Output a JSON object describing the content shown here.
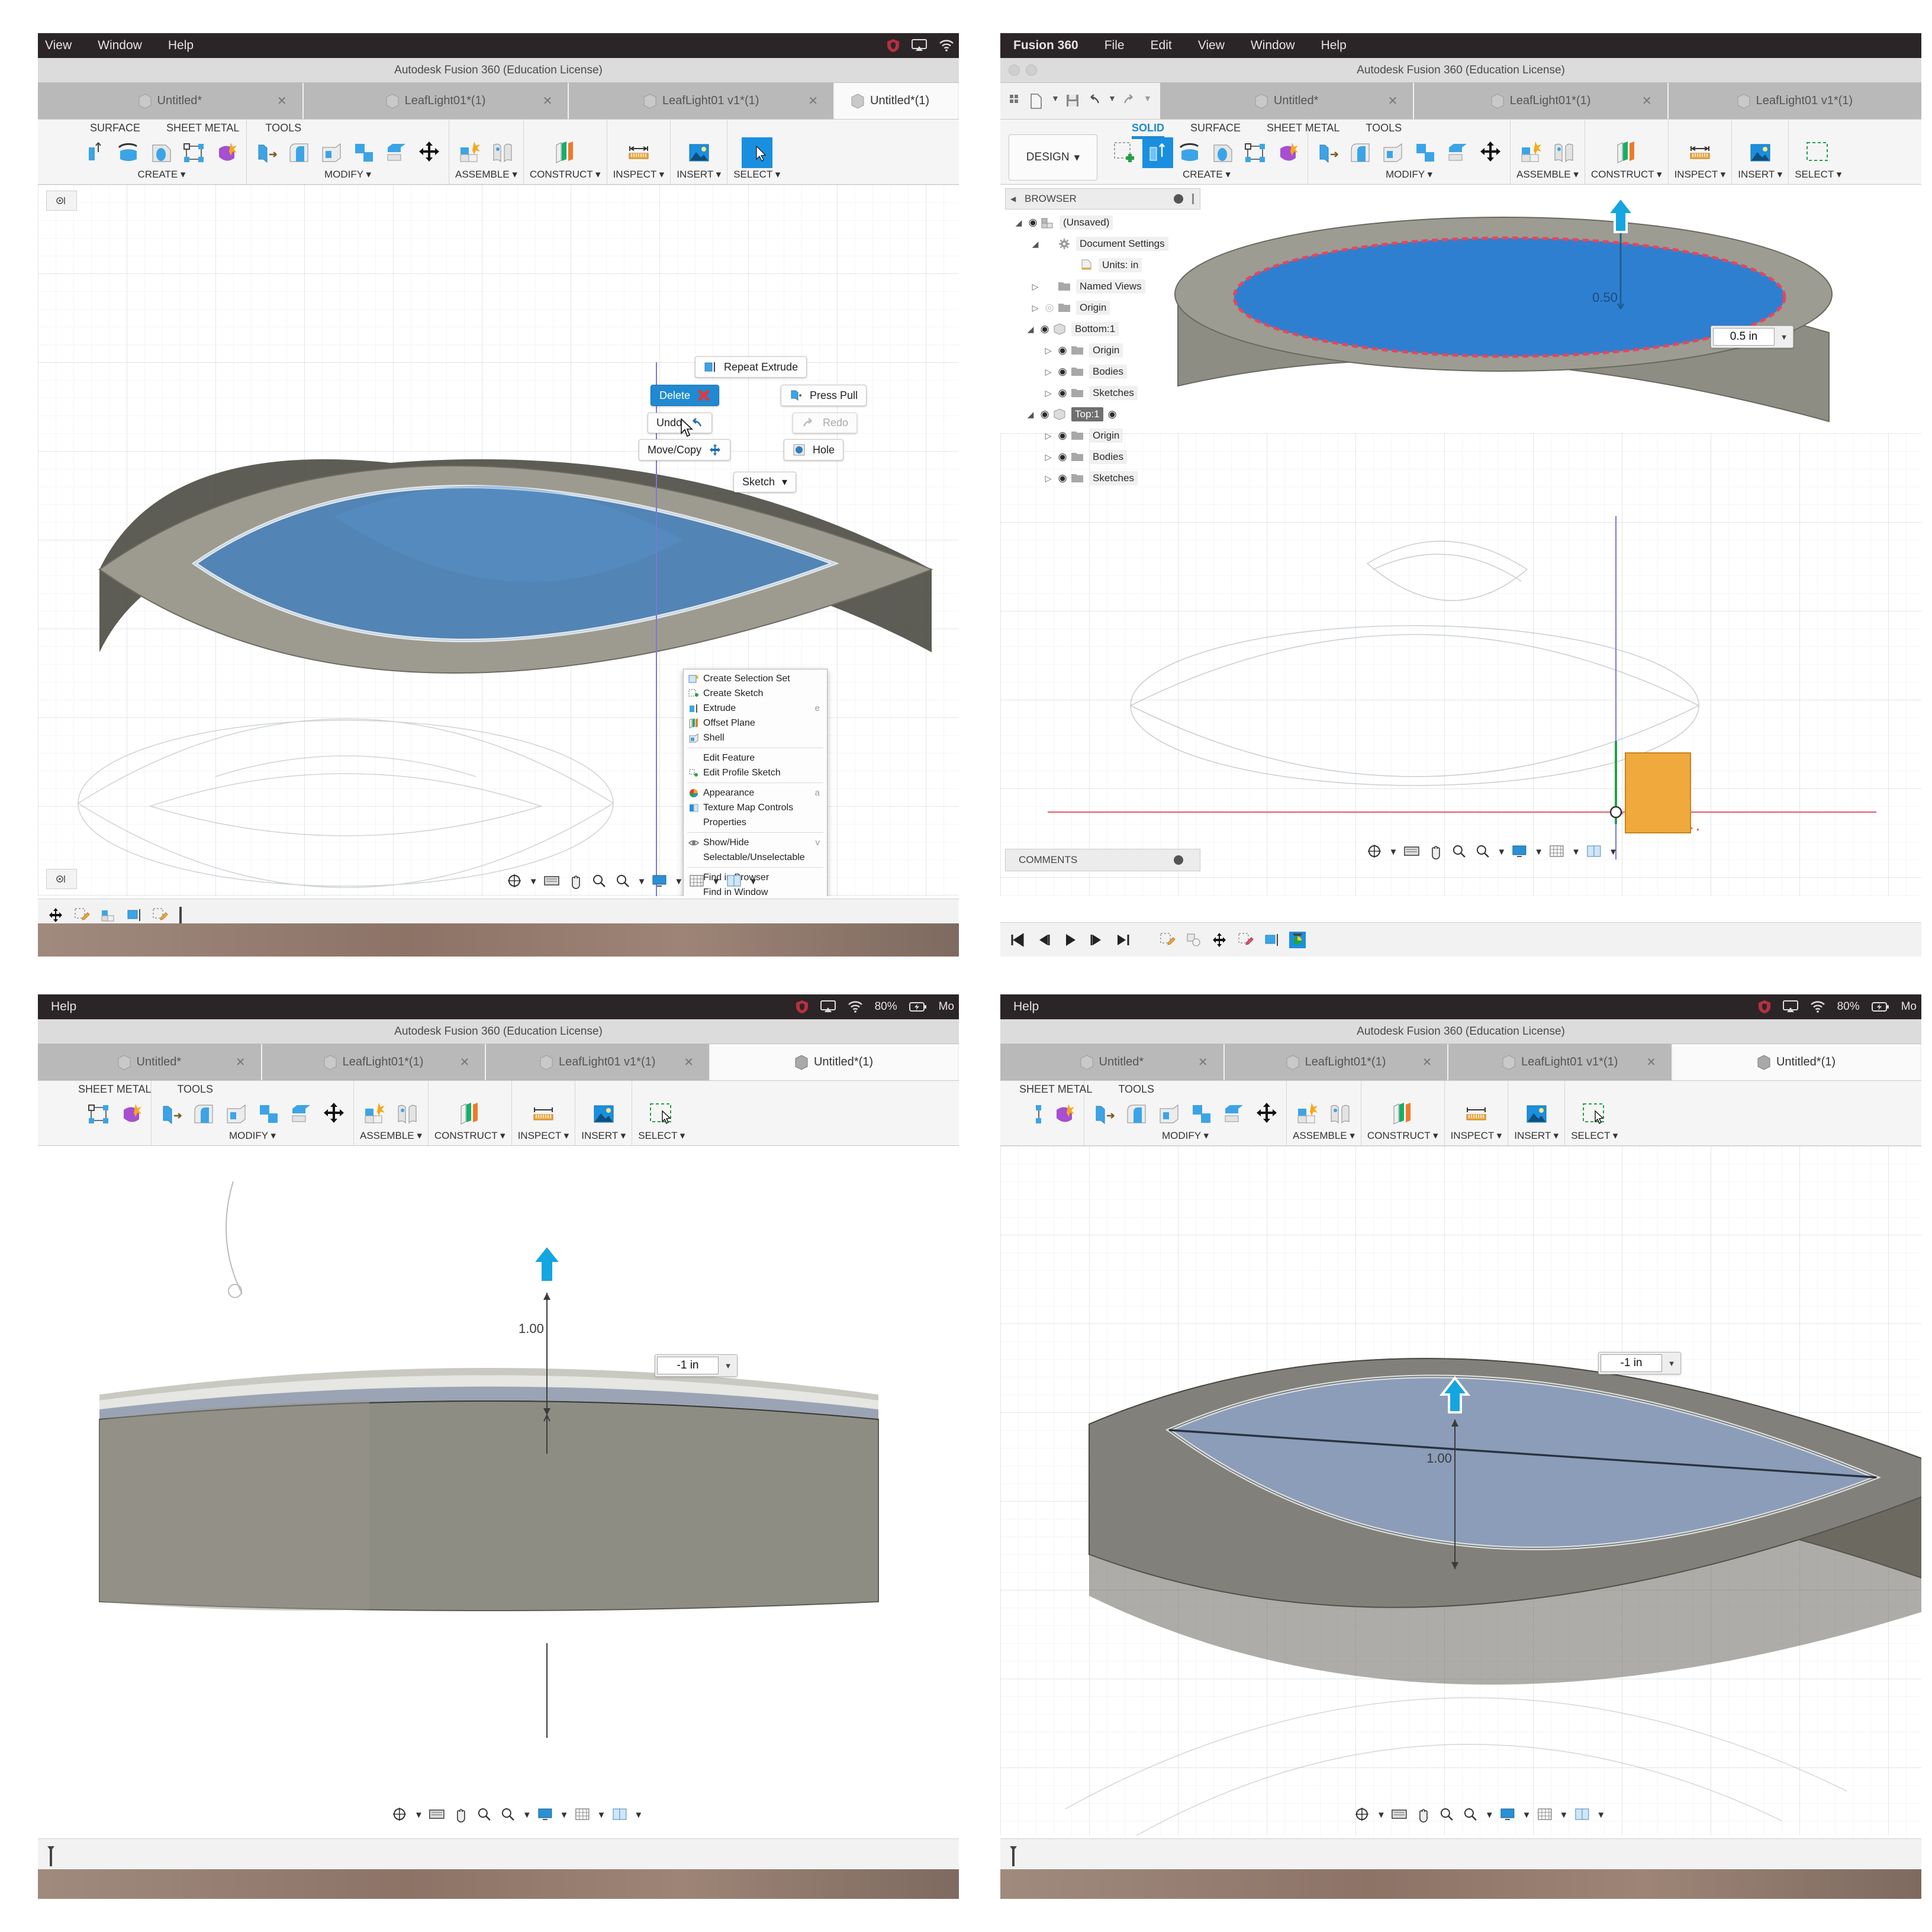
{
  "app": {
    "name": "Fusion 360",
    "window_title": "Autodesk Fusion 360 (Education License)"
  },
  "menus": {
    "full": [
      "Fusion 360",
      "File",
      "Edit",
      "View",
      "Window",
      "Help"
    ],
    "clipped_left": [
      "View",
      "Window",
      "Help"
    ],
    "help_only": [
      "Help"
    ],
    "status": {
      "battery": "80%",
      "trailing": "Mo"
    }
  },
  "document_tabs": [
    {
      "label": "Untitled*",
      "active": false,
      "closable": true
    },
    {
      "label": "LeafLight01*(1)",
      "active": false,
      "closable": true
    },
    {
      "label": "LeafLight01 v1*(1)",
      "active": false,
      "closable": true
    },
    {
      "label": "Untitled*(1)",
      "active": true,
      "closable": false
    }
  ],
  "ribbon": {
    "workspace": "DESIGN",
    "tabs": [
      {
        "label": "SOLID",
        "selected": true
      },
      {
        "label": "SURFACE",
        "selected": false
      },
      {
        "label": "SHEET METAL",
        "selected": false
      },
      {
        "label": "TOOLS",
        "selected": false
      }
    ],
    "tabs_clipped": [
      {
        "label": "SURFACE",
        "selected": false
      },
      {
        "label": "SHEET METAL",
        "selected": false
      },
      {
        "label": "TOOLS",
        "selected": false
      }
    ],
    "tabs_clipped2": [
      {
        "label": "SHEET METAL",
        "selected": false
      },
      {
        "label": "TOOLS",
        "selected": false
      }
    ],
    "groups": [
      {
        "label": "CREATE ▾",
        "icons": [
          "create-sketch-icon",
          "extrude-icon",
          "revolve-icon",
          "sweep-icon",
          "pattern-icon",
          "form-icon"
        ]
      },
      {
        "label": "MODIFY ▾",
        "icons": [
          "press-pull-icon",
          "fillet-icon",
          "shell-icon",
          "draft-icon",
          "split-face-icon",
          "move-copy-icon"
        ]
      },
      {
        "label": "ASSEMBLE ▾",
        "icons": [
          "new-component-icon",
          "joint-icon"
        ]
      },
      {
        "label": "CONSTRUCT ▾",
        "icons": [
          "offset-plane-icon"
        ]
      },
      {
        "label": "INSPECT ▾",
        "icons": [
          "measure-icon"
        ]
      },
      {
        "label": "INSERT ▾",
        "icons": [
          "insert-image-icon"
        ]
      },
      {
        "label": "SELECT ▾",
        "icons": [
          "select-icon"
        ]
      }
    ]
  },
  "browser": {
    "title": "BROWSER",
    "nodes": [
      {
        "label": "(Unsaved)",
        "indent": 0,
        "arrow": "down",
        "eye": true,
        "icon": "assembly-icon",
        "selected": false
      },
      {
        "label": "Document Settings",
        "indent": 1,
        "arrow": "down",
        "eye": false,
        "icon": "gear-icon",
        "selected": false
      },
      {
        "label": "Units: in",
        "indent": 2,
        "arrow": "none",
        "eye": false,
        "icon": "units-icon",
        "selected": false
      },
      {
        "label": "Named Views",
        "indent": 1,
        "arrow": "right",
        "eye": false,
        "icon": "folder-icon",
        "selected": false
      },
      {
        "label": "Origin",
        "indent": 1,
        "arrow": "right",
        "eye": "off",
        "icon": "folder-icon",
        "selected": false
      },
      {
        "label": "Bottom:1",
        "indent": 1,
        "arrow": "down",
        "eye": true,
        "icon": "component-icon",
        "selected": false
      },
      {
        "label": "Origin",
        "indent": 2,
        "arrow": "right",
        "eye": true,
        "icon": "folder-icon",
        "selected": false
      },
      {
        "label": "Bodies",
        "indent": 2,
        "arrow": "right",
        "eye": true,
        "icon": "folder-icon",
        "selected": false
      },
      {
        "label": "Sketches",
        "indent": 2,
        "arrow": "right",
        "eye": true,
        "icon": "folder-icon",
        "selected": false
      },
      {
        "label": "Top:1",
        "indent": 1,
        "arrow": "down",
        "eye": true,
        "icon": "component-icon",
        "selected": true
      },
      {
        "label": "Origin",
        "indent": 2,
        "arrow": "right",
        "eye": true,
        "icon": "folder-icon",
        "selected": false
      },
      {
        "label": "Bodies",
        "indent": 2,
        "arrow": "right",
        "eye": true,
        "icon": "folder-icon",
        "selected": false
      },
      {
        "label": "Sketches",
        "indent": 2,
        "arrow": "right",
        "eye": true,
        "icon": "folder-icon",
        "selected": false
      }
    ],
    "comments": "COMMENTS"
  },
  "marking_menu": {
    "items": [
      {
        "label": "Repeat Extrude",
        "state": "normal",
        "icon": "repeat-extrude-icon"
      },
      {
        "label": "Delete",
        "state": "highlighted",
        "icon": "delete-x-icon"
      },
      {
        "label": "Press Pull",
        "state": "normal",
        "icon": "press-pull-icon"
      },
      {
        "label": "Undo",
        "state": "normal",
        "icon": "undo-arrow-icon"
      },
      {
        "label": "Redo",
        "state": "disabled",
        "icon": "redo-arrow-icon"
      },
      {
        "label": "Move/Copy",
        "state": "normal",
        "icon": "move-copy-icon"
      },
      {
        "label": "Hole",
        "state": "normal",
        "icon": "hole-icon"
      },
      {
        "label": "Sketch",
        "state": "normal",
        "icon": "chevron-down-icon"
      }
    ]
  },
  "context_menu": {
    "groups": [
      [
        {
          "label": "Create Selection Set",
          "shortcut": "",
          "icon": "selection-set-icon"
        },
        {
          "label": "Create Sketch",
          "shortcut": "",
          "icon": "create-sketch-icon"
        },
        {
          "label": "Extrude",
          "shortcut": "e",
          "icon": "extrude-icon"
        },
        {
          "label": "Offset Plane",
          "shortcut": "",
          "icon": "offset-plane-icon"
        },
        {
          "label": "Shell",
          "shortcut": "",
          "icon": "shell-icon"
        }
      ],
      [
        {
          "label": "Edit Feature",
          "shortcut": "",
          "icon": ""
        },
        {
          "label": "Edit Profile Sketch",
          "shortcut": "",
          "icon": "edit-sketch-icon"
        }
      ],
      [
        {
          "label": "Appearance",
          "shortcut": "a",
          "icon": "appearance-icon"
        },
        {
          "label": "Texture Map Controls",
          "shortcut": "",
          "icon": "texture-map-icon"
        },
        {
          "label": "Properties",
          "shortcut": "",
          "icon": ""
        }
      ],
      [
        {
          "label": "Show/Hide",
          "shortcut": "v",
          "icon": "eye-icon"
        },
        {
          "label": "Selectable/Unselectable",
          "shortcut": "",
          "icon": ""
        }
      ],
      [
        {
          "label": "Find in Browser",
          "shortcut": "",
          "icon": ""
        },
        {
          "label": "Find in Window",
          "shortcut": "",
          "icon": ""
        }
      ]
    ]
  },
  "panels": {
    "top_left": {
      "name": "marking-menu-panel"
    },
    "top_right": {
      "name": "browser-extrude-panel",
      "dimension_label": "0.50",
      "value_field": "0.5 in"
    },
    "bottom_left": {
      "name": "front-view-extrude-panel",
      "dimension_label": "1.00",
      "value_field": "-1 in"
    },
    "bottom_right": {
      "name": "iso-view-extrude-panel",
      "dimension_label": "1.00",
      "value_field": "-1 in"
    }
  },
  "navbar": {
    "icons": [
      "orbit-icon",
      "chevron-down-icon",
      "look-at-icon",
      "pan-icon",
      "zoom-icon",
      "zoom-window-icon",
      "chevron-down-icon",
      "display-settings-icon",
      "chevron-down-icon",
      "grid-snap-icon",
      "chevron-down-icon",
      "viewports-icon",
      "chevron-down-icon"
    ]
  },
  "timeline": {
    "icons": [
      "skip-start-icon",
      "step-back-icon",
      "play-icon",
      "step-forward-icon",
      "skip-end-icon",
      "sketch-feature-icon",
      "component-feature-icon",
      "move-feature-icon",
      "sketch-feature-icon",
      "extrude-feature-icon",
      "appearance-feature-icon"
    ]
  },
  "colors": {
    "accent": "#1f8ad1",
    "selection_blue": "#3d7ec0",
    "body_gray": "#8b8a80",
    "sketch_orange": "#f0a93c",
    "highlight_red": "#e8455a"
  }
}
